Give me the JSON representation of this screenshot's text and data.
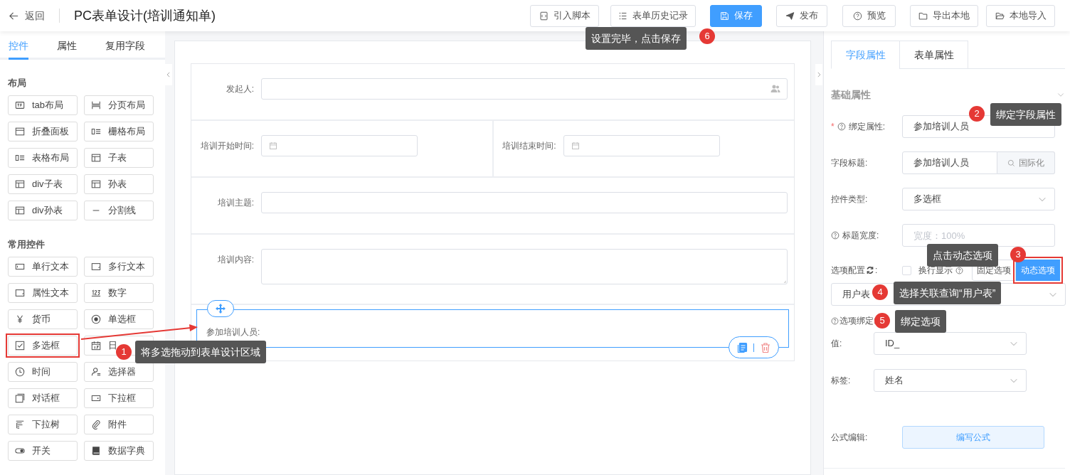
{
  "header": {
    "back_label": "返回",
    "title": "PC表单设计(培训通知单)",
    "buttons": [
      {
        "label": "引入脚本",
        "kind": "default"
      },
      {
        "label": "表单历史记录",
        "kind": "default"
      },
      {
        "label": "保存",
        "kind": "primary"
      },
      {
        "label": "发布",
        "kind": "default"
      },
      {
        "label": "预览",
        "kind": "default"
      },
      {
        "label": "导出本地",
        "kind": "default"
      },
      {
        "label": "本地导入",
        "kind": "default"
      }
    ]
  },
  "left_panel": {
    "tabs": [
      {
        "label": "控件",
        "selected": true
      },
      {
        "label": "属性",
        "selected": false
      },
      {
        "label": "复用字段",
        "selected": false
      }
    ],
    "sections": [
      {
        "title": "布局",
        "items": [
          {
            "label": "tab布局",
            "highlighted": false
          },
          {
            "label": "分页布局",
            "highlighted": false
          },
          {
            "label": "折叠面板",
            "highlighted": false
          },
          {
            "label": "栅格布局",
            "highlighted": false
          },
          {
            "label": "表格布局",
            "highlighted": false
          },
          {
            "label": "子表",
            "highlighted": false
          },
          {
            "label": "div子表",
            "highlighted": false
          },
          {
            "label": "孙表",
            "highlighted": false
          },
          {
            "label": "div孙表",
            "highlighted": false
          },
          {
            "label": "分割线",
            "highlighted": false
          }
        ]
      },
      {
        "title": "常用控件",
        "items": [
          {
            "label": "单行文本",
            "highlighted": false
          },
          {
            "label": "多行文本",
            "highlighted": false
          },
          {
            "label": "属性文本",
            "highlighted": false
          },
          {
            "label": "数字",
            "highlighted": false
          },
          {
            "label": "货币",
            "highlighted": false
          },
          {
            "label": "单选框",
            "highlighted": false
          },
          {
            "label": "多选框",
            "highlighted": true
          },
          {
            "label": "日",
            "highlighted": false
          },
          {
            "label": "时间",
            "highlighted": false
          },
          {
            "label": "选择器",
            "highlighted": false
          },
          {
            "label": "对话框",
            "highlighted": false
          },
          {
            "label": "下拉框",
            "highlighted": false
          },
          {
            "label": "下拉树",
            "highlighted": false
          },
          {
            "label": "附件",
            "highlighted": false
          },
          {
            "label": "开关",
            "highlighted": false
          },
          {
            "label": "数据字典",
            "highlighted": false
          }
        ]
      }
    ]
  },
  "canvas": {
    "rows": [
      {
        "fields": [
          {
            "label": "发起人:",
            "kind": "user"
          }
        ]
      },
      {
        "fields": [
          {
            "label": "培训开始时间:",
            "kind": "date"
          },
          {
            "label": "培训结束时间:",
            "kind": "date"
          }
        ]
      },
      {
        "fields": [
          {
            "label": "培训主题:",
            "kind": "text"
          }
        ]
      },
      {
        "fields": [
          {
            "label": "培训内容:",
            "kind": "textarea"
          }
        ]
      }
    ],
    "selected_widget": {
      "label": "参加培训人员:"
    }
  },
  "right_panel": {
    "tabs": [
      {
        "label": "字段属性",
        "selected": true
      },
      {
        "label": "表单属性",
        "selected": false
      }
    ],
    "section_title": "基础属性",
    "bind_property": {
      "label": "绑定属性:",
      "required_mark": "*",
      "value": "参加培训人员"
    },
    "field_title": {
      "label": "字段标题:",
      "value": "参加培训人员",
      "addon": "国际化"
    },
    "control_type": {
      "label": "控件类型:",
      "value": "多选框"
    },
    "title_width": {
      "label": "标题宽度:",
      "placeholder": "宽度：100%"
    },
    "options_config": {
      "label": "选项配置",
      "label_colon": ":",
      "wrap_label": "换行显示",
      "wrap_checked": false,
      "modes": [
        {
          "label": "固定选项",
          "selected": false
        },
        {
          "label": "动态选项",
          "selected": true
        }
      ]
    },
    "query": {
      "value": "用户表"
    },
    "binding_label": "选项绑定:",
    "value_field": {
      "label": "值:",
      "value": "ID_"
    },
    "label_field": {
      "label": "标签:",
      "value": "姓名"
    },
    "formula": {
      "label": "公式编辑:",
      "button": "编写公式"
    }
  },
  "annotations": [
    {
      "number": "1",
      "text": "将多选拖动到表单设计区域"
    },
    {
      "number": "2",
      "text": "绑定字段属性"
    },
    {
      "number": "3",
      "text": "点击动态选项"
    },
    {
      "number": "4",
      "text": "选择关联查询“用户表”"
    },
    {
      "number": "5",
      "text": "绑定选项"
    },
    {
      "number": "6",
      "text": "设置完毕，点击保存"
    }
  ]
}
